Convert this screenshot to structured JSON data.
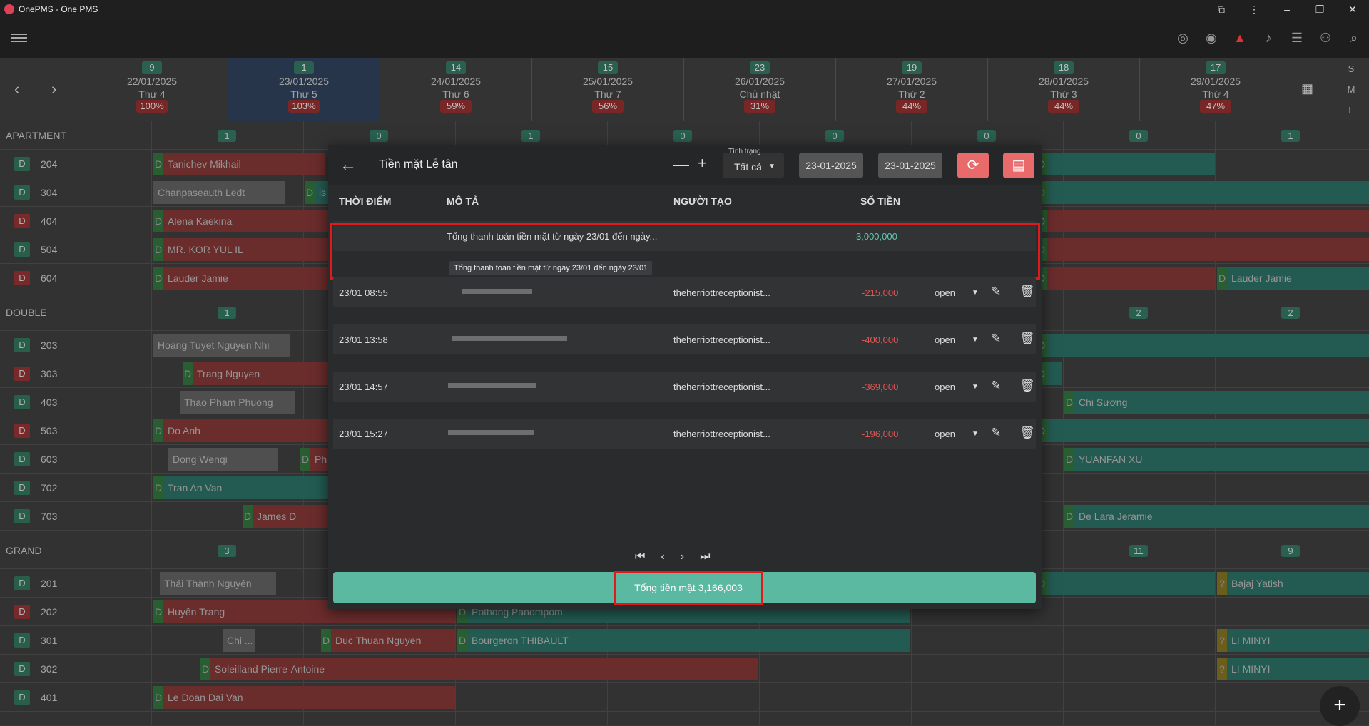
{
  "window": {
    "title": "OnePMS - One PMS"
  },
  "sml": [
    "S",
    "M",
    "L"
  ],
  "days": [
    {
      "count": "9",
      "date": "22/01/2025",
      "weekday": "Thứ 4",
      "pct": "100%"
    },
    {
      "count": "1",
      "date": "23/01/2025",
      "weekday": "Thứ 5",
      "pct": "103%"
    },
    {
      "count": "14",
      "date": "24/01/2025",
      "weekday": "Thứ 6",
      "pct": "59%"
    },
    {
      "count": "15",
      "date": "25/01/2025",
      "weekday": "Thứ 7",
      "pct": "56%"
    },
    {
      "count": "23",
      "date": "26/01/2025",
      "weekday": "Chủ nhật",
      "pct": "31%"
    },
    {
      "count": "19",
      "date": "27/01/2025",
      "weekday": "Thứ 2",
      "pct": "44%"
    },
    {
      "count": "18",
      "date": "28/01/2025",
      "weekday": "Thứ 3",
      "pct": "44%"
    },
    {
      "count": "17",
      "date": "29/01/2025",
      "weekday": "Thứ 4",
      "pct": "47%"
    }
  ],
  "grid": {
    "apartment": {
      "label": "APARTMENT",
      "counts": [
        "1",
        "0",
        "1",
        "0",
        "0",
        "0",
        "0",
        "1"
      ]
    },
    "double": {
      "label": "DOUBLE",
      "counts": [
        "1",
        "2",
        "2"
      ]
    },
    "grand": {
      "label": "GRAND",
      "counts": [
        "3",
        "11",
        "9"
      ]
    },
    "rooms": [
      {
        "type": "D",
        "num": "204"
      },
      {
        "type": "D",
        "num": "304"
      },
      {
        "type": "D",
        "num": "404"
      },
      {
        "type": "D",
        "num": "504"
      },
      {
        "type": "D",
        "num": "604"
      },
      {
        "type": "D",
        "num": "203"
      },
      {
        "type": "D",
        "num": "303"
      },
      {
        "type": "D",
        "num": "403"
      },
      {
        "type": "D",
        "num": "503"
      },
      {
        "type": "D",
        "num": "603"
      },
      {
        "type": "D",
        "num": "702"
      },
      {
        "type": "D",
        "num": "703"
      },
      {
        "type": "D",
        "num": "201"
      },
      {
        "type": "D",
        "num": "202"
      },
      {
        "type": "D",
        "num": "301"
      },
      {
        "type": "D",
        "num": "302"
      },
      {
        "type": "D",
        "num": "401"
      }
    ],
    "bookings": [
      "Tanichev Mikhail",
      "Chanpaseauth Ledt",
      "is",
      "Alena Kaekina",
      "MR. KOR YUL IL",
      "Lauder Jamie",
      "Lauder Jamie",
      "Hoang Tuyet Nguyen Nhi",
      "Trang Nguyen",
      "Thao Pham Phuong",
      "Chị Sương",
      "Do Anh",
      "Dong Wenqi",
      "Ph",
      "YUANFAN XU",
      "Tran An Van",
      "James D",
      "De Lara Jeramie",
      "Thái Thành Nguyên",
      "Bajaj Yatish",
      "Huyền Trang",
      "Pothong Panompom",
      "Chị ...",
      "Duc Thuan Nguyen",
      "Bourgeron THIBAULT",
      "LI MINYI",
      "Soleilland Pierre-Antoine",
      "LI MINYI",
      "Le Doan Dai Van"
    ]
  },
  "dialog": {
    "title": "Tiền mặt Lễ tân",
    "status_label": "Tình trạng",
    "status_value": "Tất cả",
    "date_from": "23-01-2025",
    "date_to": "23-01-2025",
    "columns": {
      "time": "THỜI ĐIỂM",
      "desc": "MÔ TẢ",
      "creator": "NGƯỜI TẠO",
      "amount": "SỐ TIỀN"
    },
    "summary": {
      "desc": "Tổng thanh toán tiền mặt từ ngày 23/01 đến ngày...",
      "amount": "3,000,000"
    },
    "tooltip": "Tổng thanh toán tiền mặt từ ngày 23/01 đến ngày 23/01",
    "rows": [
      {
        "time": "23/01 08:55",
        "creator": "theherriottreceptionist...",
        "amount": "-215,000",
        "status": "open"
      },
      {
        "time": "23/01 13:58",
        "creator": "theherriottreceptionist...",
        "amount": "-400,000",
        "status": "open"
      },
      {
        "time": "23/01 14:57",
        "creator": "theherriottreceptionist...",
        "amount": "-369,000",
        "status": "open"
      },
      {
        "time": "23/01 15:27",
        "creator": "theherriottreceptionist...",
        "amount": "-196,000",
        "status": "open"
      }
    ],
    "total": "Tổng tiền mặt 3,166,003"
  }
}
